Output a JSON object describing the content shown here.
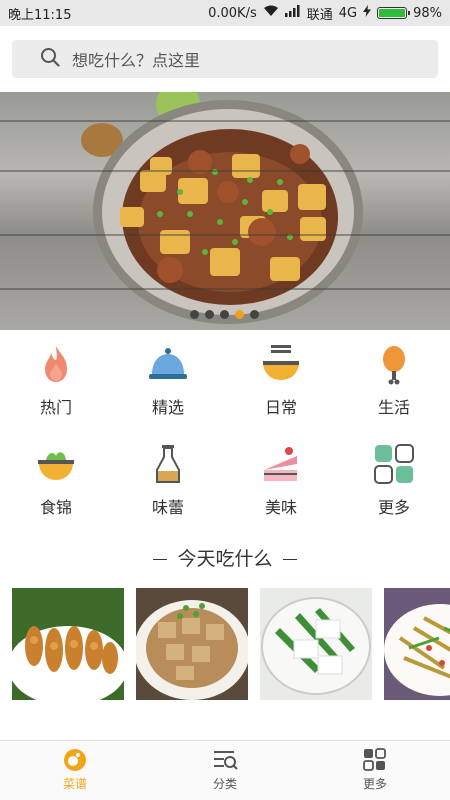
{
  "status": {
    "time": "晚上11:15",
    "speed": "0.00K/s",
    "carrier": "联通",
    "network": "4G",
    "battery": "98%",
    "battery_level": 0.98
  },
  "search": {
    "placeholder": "想吃什么？点这里"
  },
  "banner": {
    "page_count": 5,
    "active_index": 3
  },
  "categories": [
    {
      "label": "热门",
      "icon": "flame-icon"
    },
    {
      "label": "精选",
      "icon": "cloche-icon"
    },
    {
      "label": "日常",
      "icon": "noodle-bowl-icon"
    },
    {
      "label": "生活",
      "icon": "drumstick-icon"
    },
    {
      "label": "食锦",
      "icon": "salad-bowl-icon"
    },
    {
      "label": "味蕾",
      "icon": "bottle-icon"
    },
    {
      "label": "美味",
      "icon": "cake-icon"
    },
    {
      "label": "更多",
      "icon": "grid-icon"
    }
  ],
  "section": {
    "title": "今天吃什么"
  },
  "tabs": [
    {
      "label": "菜谱",
      "icon": "recipe-icon",
      "active": true
    },
    {
      "label": "分类",
      "icon": "category-search-icon",
      "active": false
    },
    {
      "label": "更多",
      "icon": "more-grid-icon",
      "active": false
    }
  ],
  "colors": {
    "accent": "#f2a51a",
    "status_bar": "#e8e8e8",
    "search_bg": "#ececec"
  }
}
